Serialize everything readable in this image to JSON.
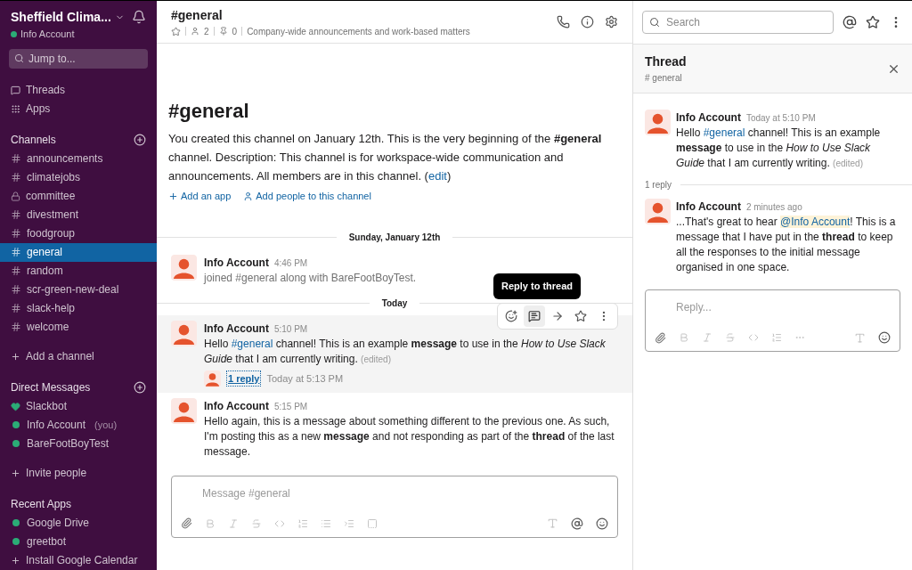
{
  "workspace": {
    "name": "Sheffield Clima...",
    "user": "Info Account",
    "online": true
  },
  "jump": {
    "placeholder": "Jump to..."
  },
  "nav": [
    {
      "kind": "threads",
      "label": "Threads"
    },
    {
      "kind": "apps",
      "label": "Apps"
    }
  ],
  "sections": [
    {
      "kind": "channels",
      "title": "Channels",
      "add": "Add a channel",
      "items": [
        {
          "kind": "channel",
          "label": "announcements",
          "selected": false
        },
        {
          "kind": "channel",
          "label": "climatejobs",
          "selected": false
        },
        {
          "kind": "private",
          "label": "committee",
          "selected": false
        },
        {
          "kind": "channel",
          "label": "divestment",
          "selected": false
        },
        {
          "kind": "channel",
          "label": "foodgroup",
          "selected": false
        },
        {
          "kind": "channel",
          "label": "general",
          "selected": true
        },
        {
          "kind": "channel",
          "label": "random",
          "selected": false
        },
        {
          "kind": "channel",
          "label": "scr-green-new-deal",
          "selected": false
        },
        {
          "kind": "channel",
          "label": "slack-help",
          "selected": false
        },
        {
          "kind": "channel",
          "label": "welcome",
          "selected": false
        }
      ]
    },
    {
      "kind": "dms",
      "title": "Direct Messages",
      "add": "Invite people",
      "items": [
        {
          "kind": "bot",
          "label": "Slackbot",
          "selected": false
        },
        {
          "kind": "person",
          "label": "Info Account",
          "note": "(you)",
          "online": true,
          "selected": false
        },
        {
          "kind": "person",
          "label": "BareFootBoyTest",
          "online": true,
          "selected": false
        }
      ]
    },
    {
      "kind": "apps",
      "title": "Recent Apps",
      "add": "Install Google Calendar",
      "items": [
        {
          "kind": "person",
          "label": "Google Drive",
          "online": true,
          "selected": false
        },
        {
          "kind": "person",
          "label": "greetbot",
          "online": true,
          "selected": false
        }
      ]
    }
  ],
  "header": {
    "title": "#general",
    "starred": false,
    "members": "2",
    "pins": "0",
    "topic": "Company-wide announcements and work-based matters"
  },
  "search": {
    "placeholder": "Search"
  },
  "intro": {
    "title": "#general",
    "text": [
      {
        "kind": "text",
        "t": "You created this channel on January 12th. This is the very beginning of the **#general** channel. Description: This channel is for workspace-wide communication and announcements. All members are in this channel. ("
      },
      {
        "kind": "link",
        "t": "edit"
      },
      {
        "kind": "text",
        "t": ")"
      }
    ],
    "actions": [
      {
        "kind": "app",
        "label": "Add an app"
      },
      {
        "kind": "people",
        "label": "Add people to this channel"
      }
    ]
  },
  "feed": [
    {
      "kind": "divider",
      "label": "Sunday, January 12th"
    },
    {
      "kind": "message",
      "author": "Info Account",
      "time": "4:46 PM",
      "system": true,
      "body": [
        {
          "kind": "text",
          "t": "joined #general along with BareFootBoyTest."
        }
      ]
    },
    {
      "kind": "divider",
      "label": "Today"
    },
    {
      "kind": "message",
      "author": "Info Account",
      "time": "5:10 PM",
      "system": false,
      "hovered": true,
      "tooltip": "Reply to thread",
      "body": [
        {
          "kind": "text",
          "t": "Hello "
        },
        {
          "kind": "link",
          "t": "#general"
        },
        {
          "kind": "text",
          "t": " channel! This is an example **message** to use in the *How to Use Slack Guide* that I am currently writing. "
        },
        {
          "kind": "edited",
          "t": "(edited)"
        }
      ],
      "replies": {
        "count": "1 reply",
        "time": "Today at 5:13 PM"
      }
    },
    {
      "kind": "message",
      "author": "Info Account",
      "time": "5:15 PM",
      "system": false,
      "body": [
        {
          "kind": "text",
          "t": "Hello again, this is a message about something different to the previous one. As such, I'm posting this as a new **message** and not responding as part of the **thread** of the last message."
        }
      ]
    }
  ],
  "composer": {
    "placeholder": "Message #general"
  },
  "thread": {
    "title": "Thread",
    "channel": "# general",
    "reply_count": "1 reply",
    "placeholder": "Reply...",
    "messages": [
      {
        "author": "Info Account",
        "time": "Today at 5:10 PM",
        "body": [
          {
            "kind": "text",
            "t": "Hello "
          },
          {
            "kind": "link",
            "t": "#general"
          },
          {
            "kind": "text",
            "t": " channel! This is an example **message** to use in the *How to Use Slack Guide* that I am currently writing. "
          },
          {
            "kind": "edited",
            "t": "(edited)"
          }
        ]
      },
      {
        "author": "Info Account",
        "time": "2 minutes ago",
        "body": [
          {
            "kind": "text",
            "t": "...That's great to hear "
          },
          {
            "kind": "mention",
            "t": "@Info Account"
          },
          {
            "kind": "text",
            "t": "! This is a message that I have put in the **thread** to keep all the responses to the initial message organised in one space."
          }
        ]
      }
    ]
  }
}
